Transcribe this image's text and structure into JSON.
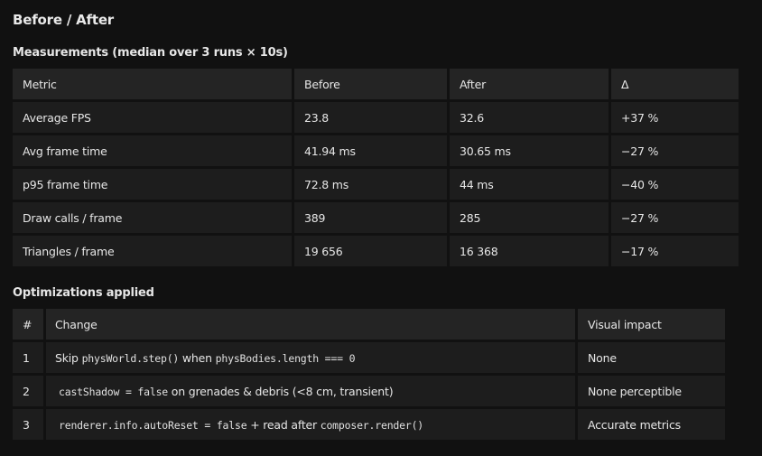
{
  "title": "Before / After",
  "measurements": {
    "heading": "Measurements (median over 3 runs × 10s)",
    "headers": [
      "Metric",
      "Before",
      "After",
      "Δ"
    ],
    "rows": [
      [
        "Average FPS",
        "23.8",
        "32.6",
        "+37 %"
      ],
      [
        "Avg frame time",
        "41.94 ms",
        "30.65 ms",
        "−27 %"
      ],
      [
        "p95 frame time",
        "72.8 ms",
        "44 ms",
        "−40 %"
      ],
      [
        "Draw calls / frame",
        "389",
        "285",
        "−27 %"
      ],
      [
        "Triangles / frame",
        "19 656",
        "16 368",
        "−17 %"
      ]
    ]
  },
  "optimizations": {
    "heading": "Optimizations applied",
    "headers": [
      "#",
      "Change",
      "Visual impact"
    ],
    "rows": [
      {
        "num": "1",
        "change": {
          "p1": "Skip ",
          "c1": "physWorld.step()",
          "p2": " when ",
          "c2": "physBodies.length === 0"
        },
        "impact": "None"
      },
      {
        "num": "2",
        "change": {
          "c1": "castShadow = false",
          "p1": " on grenades & debris (<8 cm, transient)"
        },
        "impact": "None perceptible"
      },
      {
        "num": "3",
        "change": {
          "c1": "renderer.info.autoReset = false",
          "p1": " + read after ",
          "c2": "composer.render()"
        },
        "impact": "Accurate metrics"
      }
    ]
  }
}
